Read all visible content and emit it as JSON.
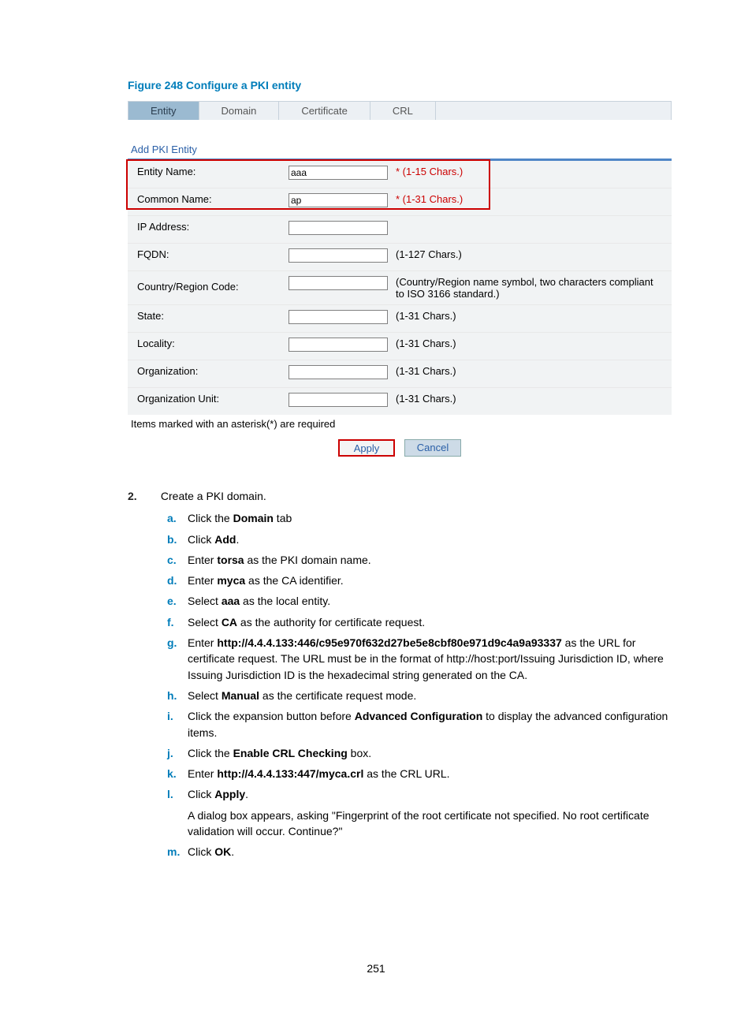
{
  "figure_caption": "Figure 248 Configure a PKI entity",
  "tabs": {
    "entity": "Entity",
    "domain": "Domain",
    "certificate": "Certificate",
    "crl": "CRL"
  },
  "subhead": "Add PKI Entity",
  "form": {
    "entity_name_label": "Entity Name:",
    "entity_name_value": "aaa",
    "entity_name_hint": "* (1-15 Chars.)",
    "common_name_label": "Common Name:",
    "common_name_value": "ap",
    "common_name_hint": "* (1-31 Chars.)",
    "ip_label": "IP Address:",
    "ip_value": "",
    "ip_hint": "",
    "fqdn_label": "FQDN:",
    "fqdn_value": "",
    "fqdn_hint": "(1-127 Chars.)",
    "country_label": "Country/Region Code:",
    "country_value": "",
    "country_hint": "(Country/Region name symbol, two characters compliant to ISO 3166 standard.)",
    "state_label": "State:",
    "state_value": "",
    "state_hint": "(1-31 Chars.)",
    "locality_label": "Locality:",
    "locality_value": "",
    "locality_hint": "(1-31 Chars.)",
    "org_label": "Organization:",
    "org_value": "",
    "org_hint": "(1-31 Chars.)",
    "orgunit_label": "Organization Unit:",
    "orgunit_value": "",
    "orgunit_hint": "(1-31 Chars.)",
    "asterisk_note": "Items marked with an asterisk(*) are required",
    "apply": "Apply",
    "cancel": "Cancel"
  },
  "step": {
    "num": "2.",
    "title": "Create a PKI domain.",
    "items": {
      "a": {
        "letter": "a.",
        "pre": "Click the ",
        "bold": "Domain",
        "post": " tab"
      },
      "b": {
        "letter": "b.",
        "pre": "Click ",
        "bold": "Add",
        "post": "."
      },
      "c": {
        "letter": "c.",
        "pre": "Enter ",
        "bold": "torsa",
        "post": " as the PKI domain name."
      },
      "d": {
        "letter": "d.",
        "pre": "Enter ",
        "bold": "myca",
        "post": " as the CA identifier."
      },
      "e": {
        "letter": "e.",
        "pre": "Select ",
        "bold": "aaa",
        "post": " as the local entity."
      },
      "f": {
        "letter": "f.",
        "pre": "Select ",
        "bold": "CA",
        "post": " as the authority for certificate request."
      },
      "g": {
        "letter": "g.",
        "pre": "Enter ",
        "bold": "http://4.4.4.133:446/c95e970f632d27be5e8cbf80e971d9c4a9a93337",
        "post": " as the URL for certificate request. The URL must be in the format of http://host:port/Issuing Jurisdiction ID, where Issuing Jurisdiction ID is the hexadecimal string generated on the CA."
      },
      "h": {
        "letter": "h.",
        "pre": "Select ",
        "bold": "Manual",
        "post": " as the certificate request mode."
      },
      "i": {
        "letter": "i.",
        "pre": "Click the expansion button before ",
        "bold": "Advanced Configuration",
        "post": " to display the advanced configuration items."
      },
      "j": {
        "letter": "j.",
        "pre": "Click the ",
        "bold": "Enable CRL Checking",
        "post": " box."
      },
      "k": {
        "letter": "k.",
        "pre": "Enter ",
        "bold": "http://4.4.4.133:447/myca.crl",
        "post": " as the CRL URL."
      },
      "l": {
        "letter": "l.",
        "pre": "Click ",
        "bold": "Apply",
        "post": ".",
        "extra": "A dialog box appears, asking \"Fingerprint of the root certificate not specified. No root certificate validation will occur. Continue?\""
      },
      "m": {
        "letter": "m.",
        "pre": "Click ",
        "bold": "OK",
        "post": "."
      }
    }
  },
  "page_number": "251"
}
